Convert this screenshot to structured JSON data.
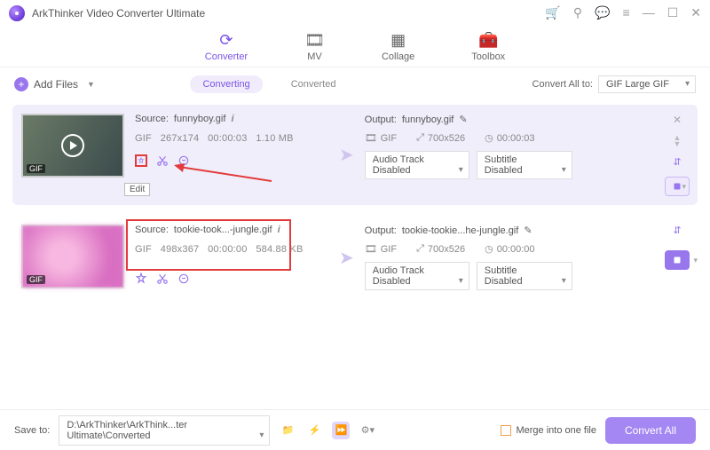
{
  "app": {
    "title": "ArkThinker Video Converter Ultimate"
  },
  "tabs": {
    "converter": "Converter",
    "mv": "MV",
    "collage": "Collage",
    "toolbox": "Toolbox"
  },
  "toolbar": {
    "add_files": "Add Files",
    "seg_converting": "Converting",
    "seg_converted": "Converted",
    "convert_all_to": "Convert All to:",
    "convert_all_fmt": "GIF Large GIF"
  },
  "items": [
    {
      "source_label": "Source:",
      "source_name": "funnyboy.gif",
      "fmt": "GIF",
      "dims": "267x174",
      "duration": "00:00:03",
      "filesize": "1.10 MB",
      "thumb_fmt": "GIF",
      "edit_tooltip": "Edit",
      "output_label": "Output:",
      "output_name": "funnyboy.gif",
      "out_fmt": "GIF",
      "out_dims": "700x526",
      "out_duration": "00:00:03",
      "audio_select": "Audio Track Disabled",
      "subtitle_select": "Subtitle Disabled"
    },
    {
      "source_label": "Source:",
      "source_name": "tookie-took...-jungle.gif",
      "fmt": "GIF",
      "dims": "498x367",
      "duration": "00:00:00",
      "filesize": "584.88 KB",
      "thumb_fmt": "GIF",
      "output_label": "Output:",
      "output_name": "tookie-tookie...he-jungle.gif",
      "out_fmt": "GIF",
      "out_dims": "700x526",
      "out_duration": "00:00:00",
      "audio_select": "Audio Track Disabled",
      "subtitle_select": "Subtitle Disabled"
    }
  ],
  "footer": {
    "saveto": "Save to:",
    "path": "D:\\ArkThinker\\ArkThink...ter Ultimate\\Converted",
    "merge": "Merge into one file",
    "convert_all": "Convert All"
  }
}
